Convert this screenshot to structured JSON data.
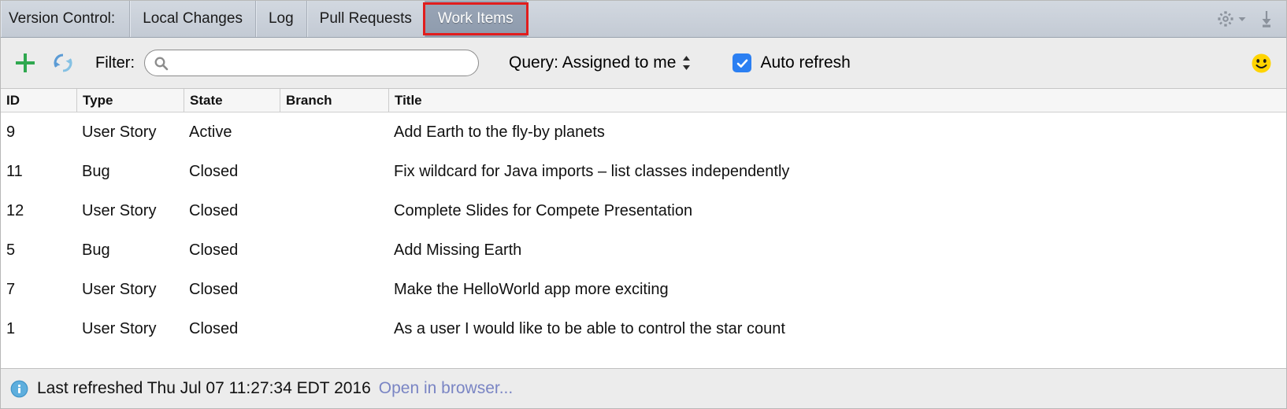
{
  "tabbar": {
    "vc_label": "Version Control:",
    "tabs": [
      {
        "label": "Local Changes",
        "selected": false
      },
      {
        "label": "Log",
        "selected": false
      },
      {
        "label": "Pull Requests",
        "selected": false
      },
      {
        "label": "Work Items",
        "selected": true
      }
    ],
    "selected_tab": "Work Items",
    "highlight_color": "#e11d1d",
    "actions": [
      {
        "name": "settings-gear",
        "label": "Settings"
      },
      {
        "name": "collapse-all",
        "label": "Hide"
      }
    ]
  },
  "toolbar": {
    "add_label": "+",
    "refresh_label": "Refresh",
    "filter_label": "Filter:",
    "search": {
      "value": "",
      "placeholder": ""
    },
    "query_label": "Query: Assigned to me",
    "query_value": "Assigned to me",
    "query_options": [
      "Assigned to me"
    ],
    "auto_refresh_label": "Auto refresh",
    "auto_refresh_checked": true,
    "accent_color": "#2b7ff2",
    "add_color": "#2fa84f",
    "smiley_color": "#ffd400"
  },
  "table": {
    "columns": [
      "ID",
      "Type",
      "State",
      "Branch",
      "Title"
    ],
    "rows": [
      {
        "id": "9",
        "type": "User Story",
        "state": "Active",
        "branch": "",
        "title": "Add Earth to the fly-by planets"
      },
      {
        "id": "11",
        "type": "Bug",
        "state": "Closed",
        "branch": "",
        "title": "Fix wildcard for Java imports – list classes independently"
      },
      {
        "id": "12",
        "type": "User Story",
        "state": "Closed",
        "branch": "",
        "title": "Complete Slides for Compete Presentation"
      },
      {
        "id": "5",
        "type": "Bug",
        "state": "Closed",
        "branch": "",
        "title": "Add Missing Earth"
      },
      {
        "id": "7",
        "type": "User Story",
        "state": "Closed",
        "branch": "",
        "title": "Make the HelloWorld app more exciting"
      },
      {
        "id": "1",
        "type": "User Story",
        "state": "Closed",
        "branch": "",
        "title": "As a user I would like to be able to control the star count"
      }
    ]
  },
  "statusbar": {
    "message": "Last refreshed Thu Jul 07 11:27:34 EDT 2016",
    "link": "Open in browser...",
    "link_color": "#7a85c4"
  }
}
